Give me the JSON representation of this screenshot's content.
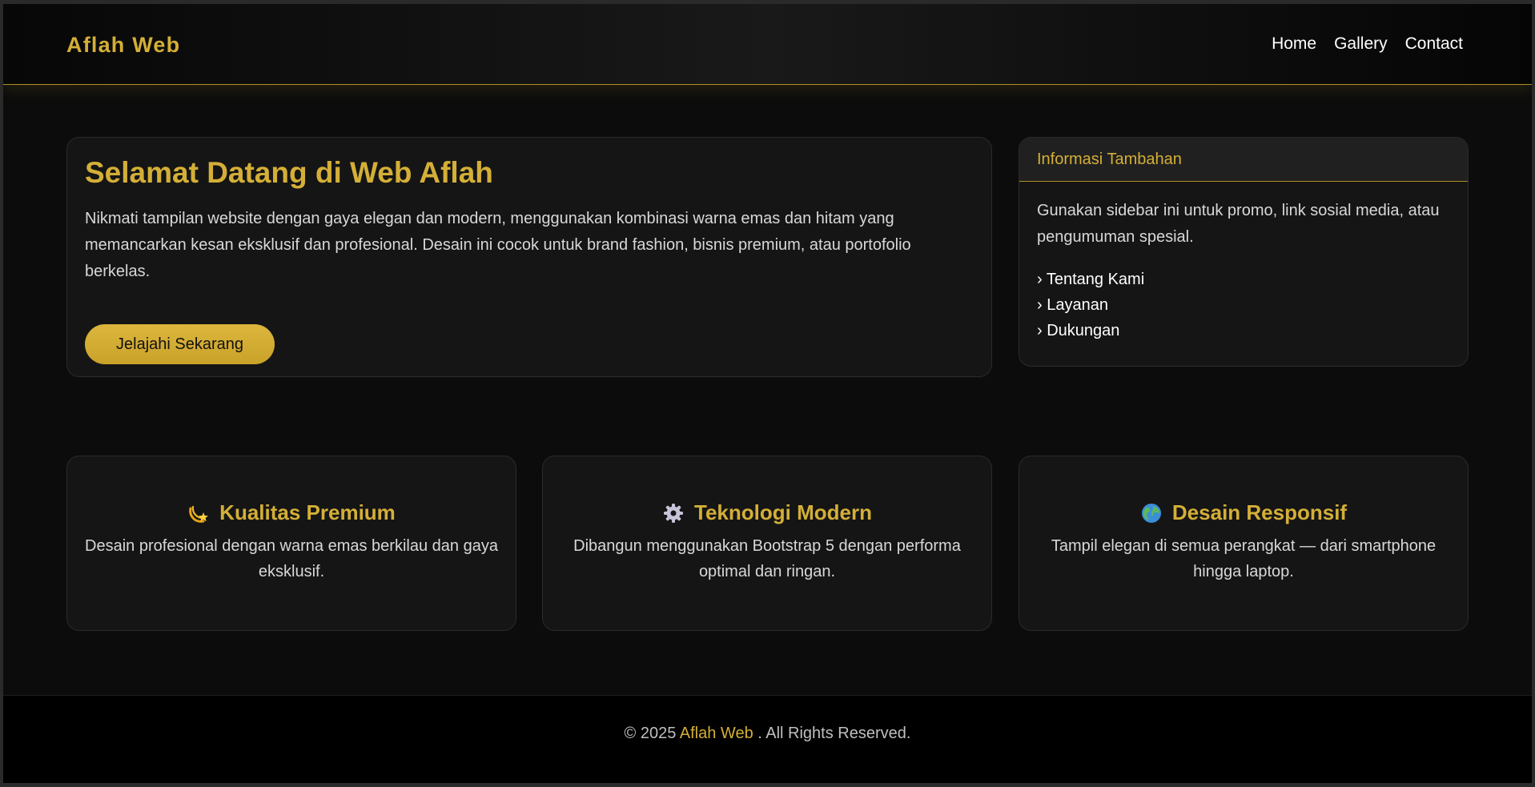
{
  "nav": {
    "brand": "Aflah Web",
    "links": [
      "Home",
      "Gallery",
      "Contact"
    ]
  },
  "hero": {
    "title": "Selamat Datang di Web Aflah",
    "text": "Nikmati tampilan website dengan gaya elegan dan modern, menggunakan kombinasi warna emas dan hitam yang memancarkan kesan eksklusif dan profesional. Desain ini cocok untuk brand fashion, bisnis premium, atau portofolio berkelas.",
    "button": "Jelajahi Sekarang"
  },
  "sidebar": {
    "header": "Informasi Tambahan",
    "text": "Gunakan sidebar ini untuk promo, link sosial media, atau pengumuman spesial.",
    "links": [
      "› Tentang Kami",
      "› Layanan",
      "› Dukungan"
    ]
  },
  "features": [
    {
      "icon": "dizzy-star-icon",
      "title": "Kualitas Premium",
      "desc": "Desain profesional dengan warna emas berkilau dan gaya eksklusif."
    },
    {
      "icon": "gear-icon",
      "title": "Teknologi Modern",
      "desc": "Dibangun menggunakan Bootstrap 5 dengan performa optimal dan ringan."
    },
    {
      "icon": "globe-icon",
      "title": "Desain Responsif",
      "desc": "Tampil elegan di semua perangkat — dari smartphone hingga laptop."
    }
  ],
  "footer": {
    "prefix": "© 2025",
    "brand": "Aflah Web",
    "suffix": ". All Rights Reserved."
  },
  "colors": {
    "accent": "#d4af37",
    "background": "#0c0c0c",
    "card": "#151515"
  }
}
